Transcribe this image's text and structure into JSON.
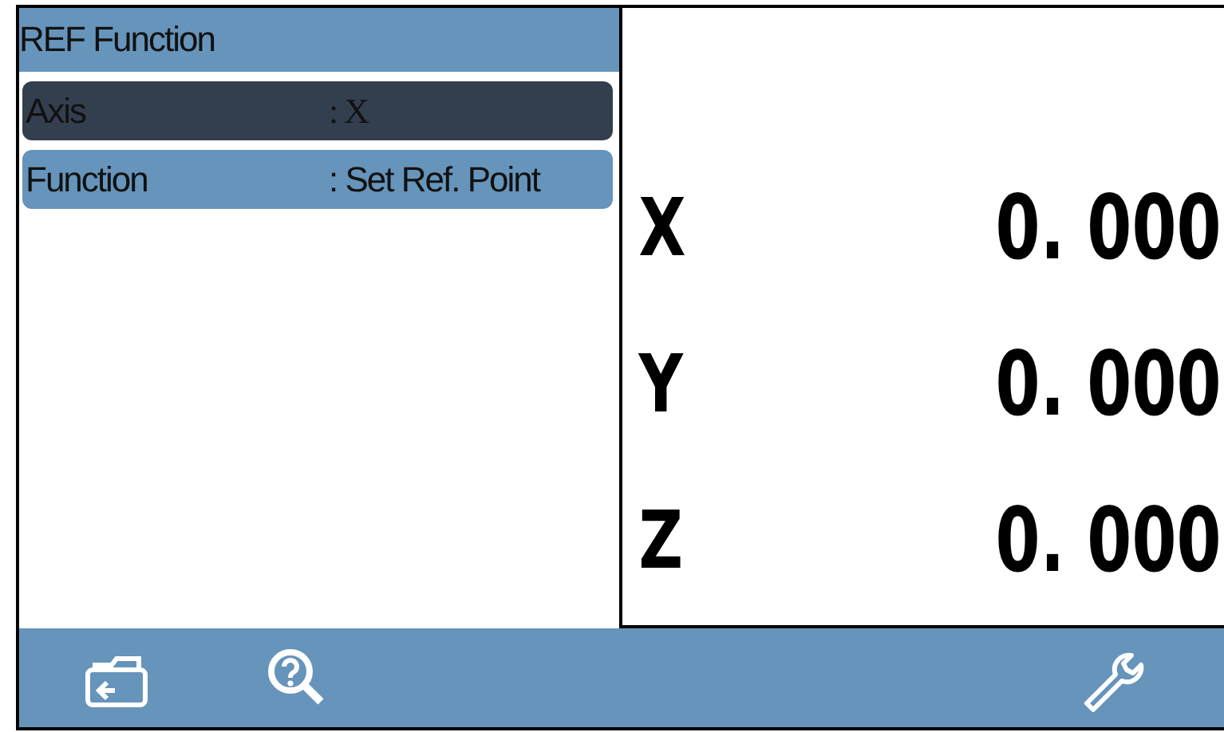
{
  "panel": {
    "title": "REF Function",
    "rows": [
      {
        "label": "Axis",
        "value": ": X",
        "selected": true
      },
      {
        "label": "Function",
        "value": ": Set Ref. Point",
        "selected": false
      }
    ]
  },
  "readout": [
    {
      "axis": "X",
      "value": "0. 000"
    },
    {
      "axis": "Y",
      "value": "0. 000"
    },
    {
      "axis": "Z",
      "value": "0. 000"
    }
  ],
  "toolbar": [
    {
      "kind": "folder-back"
    },
    {
      "kind": "help-search"
    },
    {
      "kind": "spacer"
    },
    {
      "kind": "wrench"
    }
  ]
}
